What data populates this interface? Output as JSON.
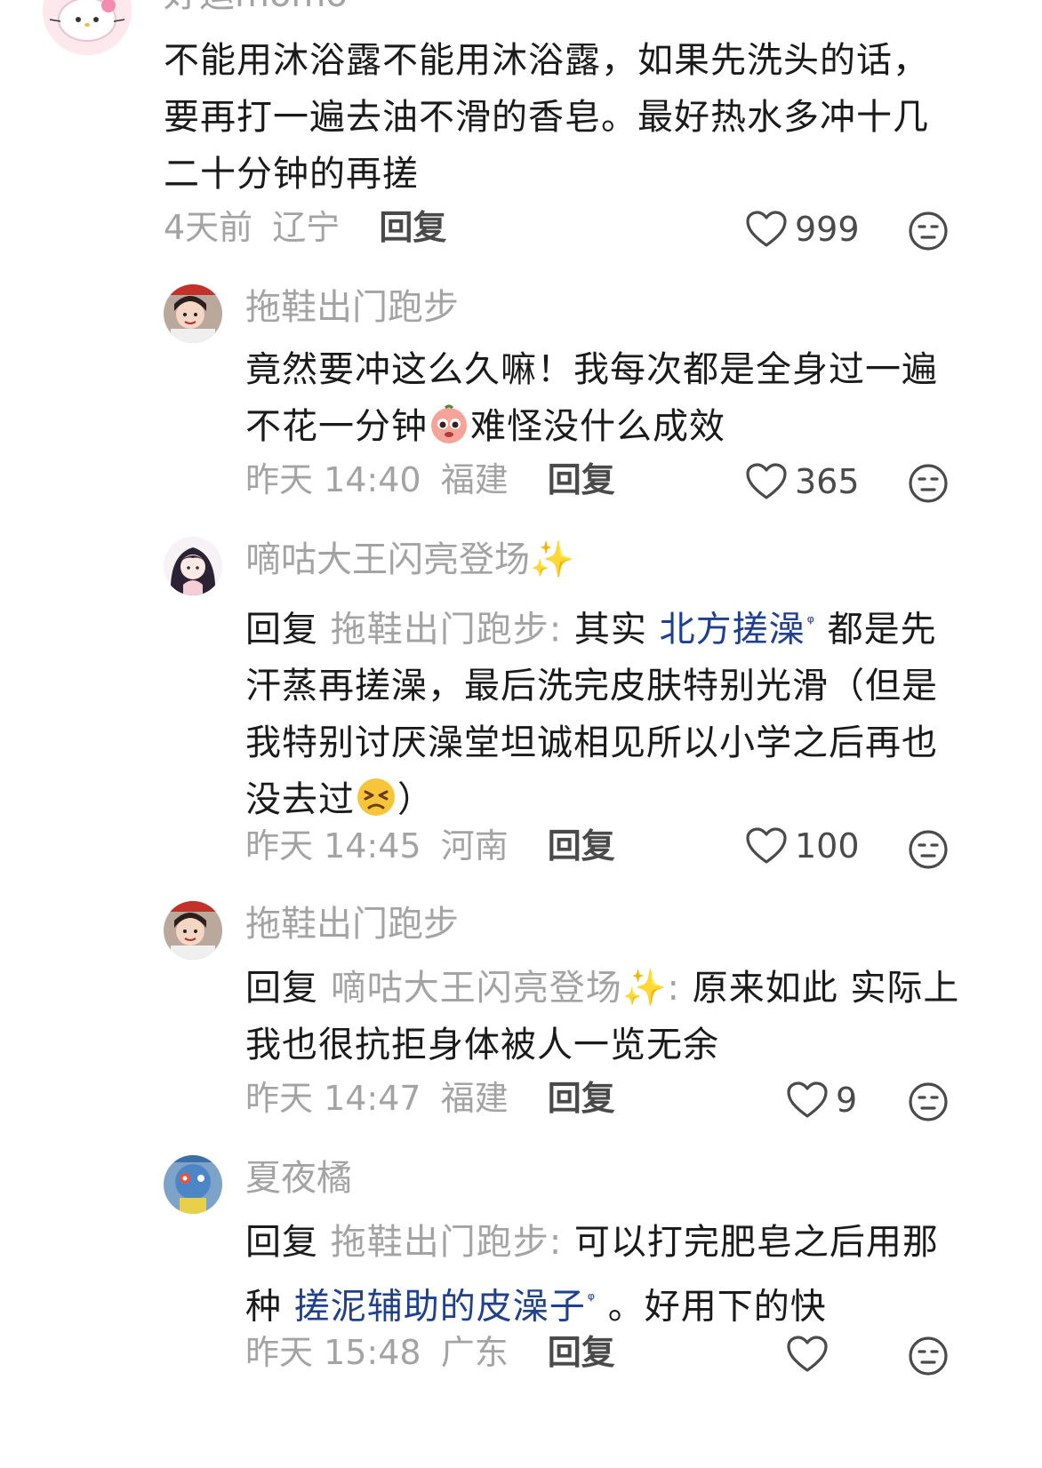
{
  "comments": [
    {
      "username": "好运momo",
      "text_lines": [
        "不能用沐浴露不能用沐浴露，如果先洗头的话，",
        "要再打一遍去油不滑的香皂。最好热水多冲十几",
        "二十分钟的再搓"
      ],
      "time": "4天前",
      "location": "辽宁",
      "reply_label": "回复",
      "likes": "999",
      "avatar_icon": "hello-kitty-avatar"
    },
    {
      "username": "拖鞋出门跑步",
      "text_line1": "竟然要冲这么久嘛！我每次都是全身过一遍",
      "text_line2_a": "不花一分钟",
      "text_line2_b": "难怪没什么成效",
      "inline_emoji": "pleading-face-emoji",
      "time": "昨天 14:40",
      "location": "福建",
      "reply_label": "回复",
      "likes": "365",
      "avatar_icon": "person-avatar"
    },
    {
      "username": "嘀咕大王闪亮登场✨",
      "reply_word": "回复",
      "reply_target": "拖鞋出门跑步:",
      "line1_a": " 其实 ",
      "line1_link": "北方搓澡",
      "line1_b": " 都是先",
      "line2": "汗蒸再搓澡，最后洗完皮肤特别光滑（但是",
      "line3": "我特别讨厌澡堂坦诚相见所以小学之后再也",
      "line4_a": "没去过",
      "line4_b": "）",
      "inline_emoji": "persevering-face-emoji",
      "time": "昨天 14:45",
      "location": "河南",
      "reply_label": "回复",
      "likes": "100",
      "avatar_icon": "girl-avatar"
    },
    {
      "username": "拖鞋出门跑步",
      "reply_word": "回复",
      "reply_target": "嘀咕大王闪亮登场✨:",
      "line1_a": " 原来如此 实际上",
      "line2": "我也很抗拒身体被人一览无余",
      "time": "昨天 14:47",
      "location": "福建",
      "reply_label": "回复",
      "likes": "9",
      "avatar_icon": "person-avatar"
    },
    {
      "username": "夏夜橘",
      "reply_word": "回复",
      "reply_target": "拖鞋出门跑步:",
      "line1_a": " 可以打完肥皂之后用那",
      "line2_a": "种 ",
      "line2_link": "搓泥辅助的皮澡子",
      "line2_b": " 。好用下的快",
      "time": "昨天 15:48",
      "location": "广东",
      "reply_label": "回复",
      "likes": "",
      "avatar_icon": "toy-avatar"
    }
  ],
  "search_marker": "ᵠ",
  "colors": {
    "username": "#a3a3a3",
    "text": "#1a1a1a",
    "link": "#1f3f8f",
    "meta": "#a3a3a3"
  }
}
